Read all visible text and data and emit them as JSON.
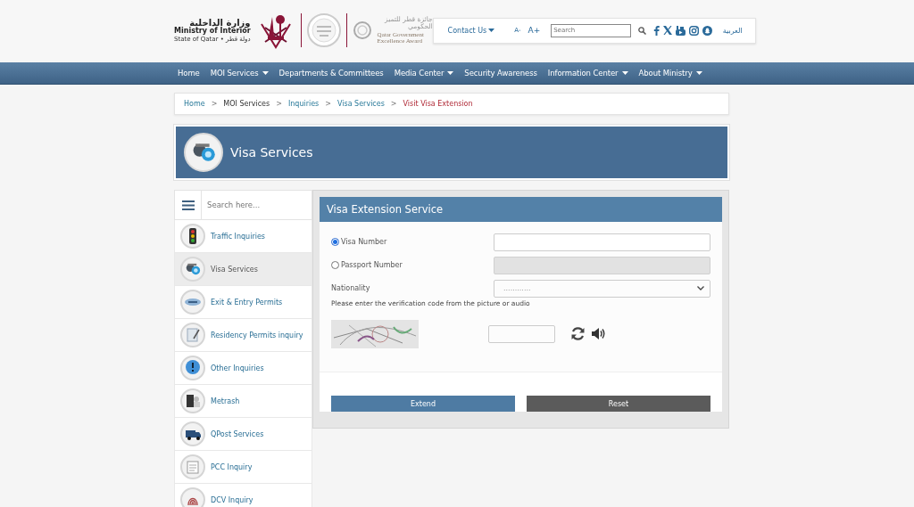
{
  "header": {
    "logo": {
      "arabic_name": "وزارة الداخلية",
      "name": "Ministry of Interior",
      "state": "State of Qatar • دولة قطر"
    },
    "award": {
      "arabic_name": "جائزة قطر للتميز الحكومي",
      "name_line_1": "Qatar Government",
      "name_line_2": "Excellence Award"
    },
    "contact": "Contact Us",
    "font_smaller": "A-",
    "font_larger": "A+",
    "search": {
      "placeholder": "Search"
    },
    "language": "العربية"
  },
  "nav": [
    {
      "label": "Home",
      "dropdown": false
    },
    {
      "label": "MOI Services",
      "dropdown": true
    },
    {
      "label": "Departments & Committees",
      "dropdown": false
    },
    {
      "label": "Media Center",
      "dropdown": true
    },
    {
      "label": "Security Awareness",
      "dropdown": false
    },
    {
      "label": "Information Center",
      "dropdown": true
    },
    {
      "label": "About Ministry",
      "dropdown": true
    }
  ],
  "breadcrumb": {
    "items": [
      {
        "label": "Home",
        "current": false
      },
      {
        "label": "MOI Services",
        "current": false
      },
      {
        "label": "Inquiries",
        "current": false
      },
      {
        "label": "Visa Services",
        "current": false
      },
      {
        "label": "Visit Visa Extension",
        "current": true
      }
    ],
    "separators": [
      ">",
      ">",
      ">",
      ">"
    ]
  },
  "banner": {
    "title": "Visa Services"
  },
  "sidebar": {
    "search": {
      "placeholder": "Search here..."
    },
    "items": [
      {
        "label": "Traffic Inquiries",
        "selected": false
      },
      {
        "label": "Visa Services",
        "selected": true
      },
      {
        "label": "Exit & Entry Permits",
        "selected": false
      },
      {
        "label": "Residency Permits inquiry",
        "selected": false
      },
      {
        "label": "Other Inquiries",
        "selected": false
      },
      {
        "label": "Metrash",
        "selected": false
      },
      {
        "label": "QPost Services",
        "selected": false
      },
      {
        "label": "PCC Inquiry",
        "selected": false
      },
      {
        "label": "DCV Inquiry",
        "selected": false
      }
    ]
  },
  "form": {
    "title": "Visa Extension Service",
    "options": [
      {
        "label": "Visa Number",
        "selected": true,
        "field_disabled": false
      },
      {
        "label": "Passport Number",
        "selected": false,
        "field_disabled": true
      }
    ],
    "nationality": {
      "label": "Nationality",
      "value": "............"
    },
    "verification_hint": "Please enter the verification code from the picture or audio",
    "buttons": [
      {
        "label": "Extend",
        "kind": "primary"
      },
      {
        "label": "Reset",
        "kind": "secondary"
      }
    ]
  }
}
